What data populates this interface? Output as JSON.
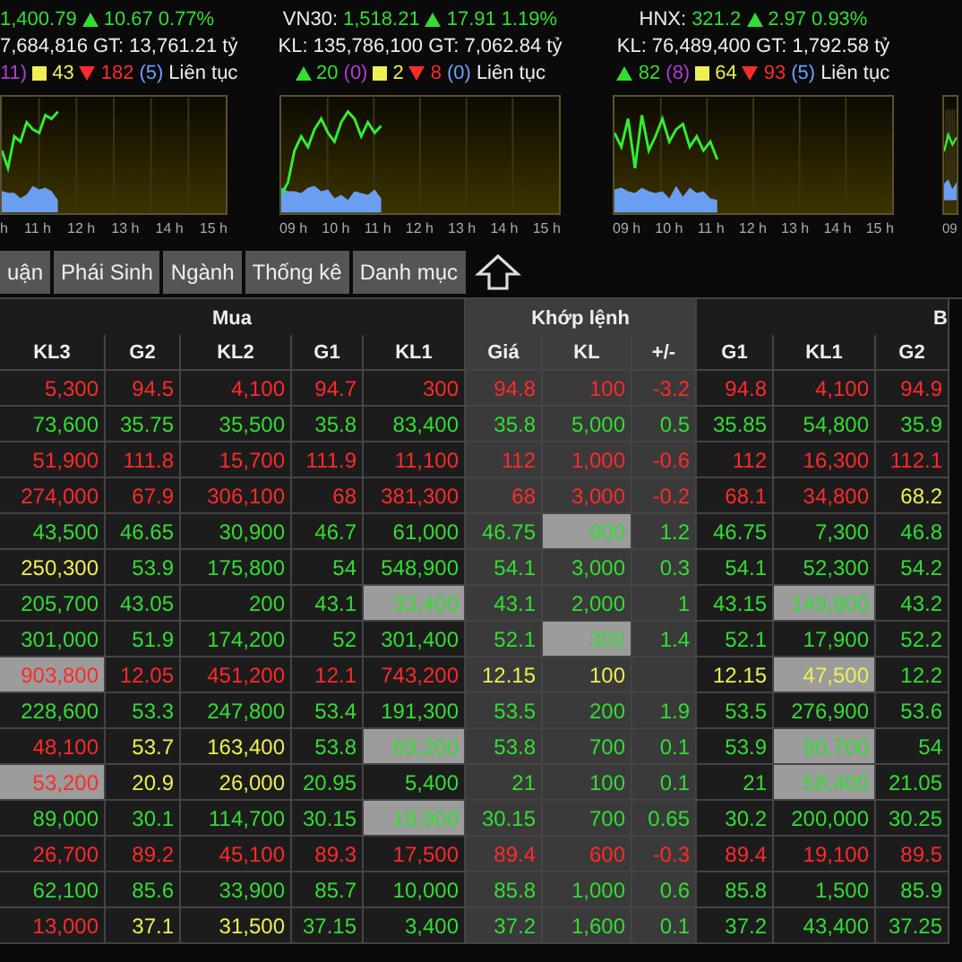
{
  "index_panels": [
    {
      "value": "1,400.79",
      "change": "10.67",
      "percent": "0.77%",
      "volume_line": "7,684,816 GT: 13,761.21 tỷ",
      "breadth": [
        {
          "kind": "ceiling",
          "text": "11)"
        },
        {
          "kind": "same",
          "text": "43"
        },
        {
          "kind": "down",
          "text": "182"
        },
        {
          "kind": "floor",
          "text": "(5)"
        },
        {
          "kind": "status",
          "text": "Liên tục"
        }
      ],
      "axis": [
        "h",
        "11 h",
        "12 h",
        "13 h",
        "14 h",
        "15 h"
      ]
    },
    {
      "title": "VN30:",
      "value": "1,518.21",
      "change": "17.91",
      "percent": "1.19%",
      "volume_line": "KL: 135,786,100 GT: 7,062.84 tỷ",
      "breadth": [
        {
          "kind": "up",
          "text": "20"
        },
        {
          "kind": "ceiling",
          "text": "(0)"
        },
        {
          "kind": "same",
          "text": "2"
        },
        {
          "kind": "down",
          "text": "8"
        },
        {
          "kind": "floor",
          "text": "(0)"
        },
        {
          "kind": "status",
          "text": "Liên tục"
        }
      ],
      "axis": [
        "09 h",
        "10 h",
        "11 h",
        "12 h",
        "13 h",
        "14 h",
        "15 h"
      ]
    },
    {
      "title": "HNX:",
      "value": "321.2",
      "change": "2.97",
      "percent": "0.93%",
      "volume_line": "KL: 76,489,400 GT: 1,792.58 tỷ",
      "breadth": [
        {
          "kind": "up",
          "text": "82"
        },
        {
          "kind": "ceiling",
          "text": "(8)"
        },
        {
          "kind": "same",
          "text": "64"
        },
        {
          "kind": "down",
          "text": "93"
        },
        {
          "kind": "floor",
          "text": "(5)"
        },
        {
          "kind": "status",
          "text": "Liên tục"
        }
      ],
      "axis": [
        "09 h",
        "10 h",
        "11 h",
        "12 h",
        "13 h",
        "14 h",
        "15 h"
      ]
    },
    {
      "axis": [
        "09"
      ]
    }
  ],
  "tabs": [
    {
      "label": "uận",
      "selected": false
    },
    {
      "label": "Phái Sinh",
      "selected": false
    },
    {
      "label": "Ngành",
      "selected": false
    },
    {
      "label": "Thống kê",
      "selected": false
    },
    {
      "label": "Danh mục",
      "selected": false
    }
  ],
  "table": {
    "groups": [
      {
        "kind": "buy",
        "label": "Mua",
        "columns": [
          "KL3",
          "G2",
          "KL2",
          "G1",
          "KL1"
        ]
      },
      {
        "kind": "match",
        "label": "Khớp lệnh",
        "columns": [
          "Giá",
          "KL",
          "+/-"
        ]
      },
      {
        "kind": "sell",
        "label": "B",
        "columns": [
          "G1",
          "KL1",
          "G2"
        ]
      }
    ],
    "rows": [
      {
        "cells": [
          {
            "text": "5,300",
            "kind": "down",
            "highlighted": false
          },
          {
            "text": "94.5",
            "kind": "down",
            "highlighted": false
          },
          {
            "text": "4,100",
            "kind": "down",
            "highlighted": false
          },
          {
            "text": "94.7",
            "kind": "down",
            "highlighted": false
          },
          {
            "text": "300",
            "kind": "down",
            "highlighted": false
          },
          {
            "text": "94.8",
            "kind": "down",
            "highlighted": false
          },
          {
            "text": "100",
            "kind": "down",
            "highlighted": false
          },
          {
            "text": "-3.2",
            "kind": "down",
            "highlighted": false
          },
          {
            "text": "94.8",
            "kind": "down",
            "highlighted": false
          },
          {
            "text": "4,100",
            "kind": "down",
            "highlighted": false
          },
          {
            "text": "94.9",
            "kind": "down",
            "highlighted": false
          }
        ]
      },
      {
        "cells": [
          {
            "text": "73,600",
            "kind": "up",
            "highlighted": false
          },
          {
            "text": "35.75",
            "kind": "up",
            "highlighted": false
          },
          {
            "text": "35,500",
            "kind": "up",
            "highlighted": false
          },
          {
            "text": "35.8",
            "kind": "up",
            "highlighted": false
          },
          {
            "text": "83,400",
            "kind": "up",
            "highlighted": false
          },
          {
            "text": "35.8",
            "kind": "up",
            "highlighted": false
          },
          {
            "text": "5,000",
            "kind": "up",
            "highlighted": false
          },
          {
            "text": "0.5",
            "kind": "up",
            "highlighted": false
          },
          {
            "text": "35.85",
            "kind": "up",
            "highlighted": false
          },
          {
            "text": "54,800",
            "kind": "up",
            "highlighted": false
          },
          {
            "text": "35.9",
            "kind": "up",
            "highlighted": false
          }
        ]
      },
      {
        "cells": [
          {
            "text": "51,900",
            "kind": "down",
            "highlighted": false
          },
          {
            "text": "111.8",
            "kind": "down",
            "highlighted": false
          },
          {
            "text": "15,700",
            "kind": "down",
            "highlighted": false
          },
          {
            "text": "111.9",
            "kind": "down",
            "highlighted": false
          },
          {
            "text": "11,100",
            "kind": "down",
            "highlighted": false
          },
          {
            "text": "112",
            "kind": "down",
            "highlighted": false
          },
          {
            "text": "1,000",
            "kind": "down",
            "highlighted": false
          },
          {
            "text": "-0.6",
            "kind": "down",
            "highlighted": false
          },
          {
            "text": "112",
            "kind": "down",
            "highlighted": false
          },
          {
            "text": "16,300",
            "kind": "down",
            "highlighted": false
          },
          {
            "text": "112.1",
            "kind": "down",
            "highlighted": false
          }
        ]
      },
      {
        "cells": [
          {
            "text": "274,000",
            "kind": "down",
            "highlighted": false
          },
          {
            "text": "67.9",
            "kind": "down",
            "highlighted": false
          },
          {
            "text": "306,100",
            "kind": "down",
            "highlighted": false
          },
          {
            "text": "68",
            "kind": "down",
            "highlighted": false
          },
          {
            "text": "381,300",
            "kind": "down",
            "highlighted": false
          },
          {
            "text": "68",
            "kind": "down",
            "highlighted": false
          },
          {
            "text": "3,000",
            "kind": "down",
            "highlighted": false
          },
          {
            "text": "-0.2",
            "kind": "down",
            "highlighted": false
          },
          {
            "text": "68.1",
            "kind": "down",
            "highlighted": false
          },
          {
            "text": "34,800",
            "kind": "down",
            "highlighted": false
          },
          {
            "text": "68.2",
            "kind": "reference",
            "highlighted": false
          }
        ]
      },
      {
        "cells": [
          {
            "text": "43,500",
            "kind": "up",
            "highlighted": false
          },
          {
            "text": "46.65",
            "kind": "up",
            "highlighted": false
          },
          {
            "text": "30,900",
            "kind": "up",
            "highlighted": false
          },
          {
            "text": "46.7",
            "kind": "up",
            "highlighted": false
          },
          {
            "text": "61,000",
            "kind": "up",
            "highlighted": false
          },
          {
            "text": "46.75",
            "kind": "up",
            "highlighted": false
          },
          {
            "text": "900",
            "kind": "up",
            "highlighted": true
          },
          {
            "text": "1.2",
            "kind": "up",
            "highlighted": false
          },
          {
            "text": "46.75",
            "kind": "up",
            "highlighted": false
          },
          {
            "text": "7,300",
            "kind": "up",
            "highlighted": false
          },
          {
            "text": "46.8",
            "kind": "up",
            "highlighted": false
          }
        ]
      },
      {
        "cells": [
          {
            "text": "250,300",
            "kind": "reference",
            "highlighted": false
          },
          {
            "text": "53.9",
            "kind": "up",
            "highlighted": false
          },
          {
            "text": "175,800",
            "kind": "up",
            "highlighted": false
          },
          {
            "text": "54",
            "kind": "up",
            "highlighted": false
          },
          {
            "text": "548,900",
            "kind": "up",
            "highlighted": false
          },
          {
            "text": "54.1",
            "kind": "up",
            "highlighted": false
          },
          {
            "text": "3,000",
            "kind": "up",
            "highlighted": false
          },
          {
            "text": "0.3",
            "kind": "up",
            "highlighted": false
          },
          {
            "text": "54.1",
            "kind": "up",
            "highlighted": false
          },
          {
            "text": "52,300",
            "kind": "up",
            "highlighted": false
          },
          {
            "text": "54.2",
            "kind": "up",
            "highlighted": false
          }
        ]
      },
      {
        "cells": [
          {
            "text": "205,700",
            "kind": "up",
            "highlighted": false
          },
          {
            "text": "43.05",
            "kind": "up",
            "highlighted": false
          },
          {
            "text": "200",
            "kind": "up",
            "highlighted": false
          },
          {
            "text": "43.1",
            "kind": "up",
            "highlighted": false
          },
          {
            "text": "33,400",
            "kind": "up",
            "highlighted": true
          },
          {
            "text": "43.1",
            "kind": "up",
            "highlighted": false
          },
          {
            "text": "2,000",
            "kind": "up",
            "highlighted": false
          },
          {
            "text": "1",
            "kind": "up",
            "highlighted": false
          },
          {
            "text": "43.15",
            "kind": "up",
            "highlighted": false
          },
          {
            "text": "149,800",
            "kind": "up",
            "highlighted": true
          },
          {
            "text": "43.2",
            "kind": "up",
            "highlighted": false
          }
        ]
      },
      {
        "cells": [
          {
            "text": "301,000",
            "kind": "up",
            "highlighted": false
          },
          {
            "text": "51.9",
            "kind": "up",
            "highlighted": false
          },
          {
            "text": "174,200",
            "kind": "up",
            "highlighted": false
          },
          {
            "text": "52",
            "kind": "up",
            "highlighted": false
          },
          {
            "text": "301,400",
            "kind": "up",
            "highlighted": false
          },
          {
            "text": "52.1",
            "kind": "up",
            "highlighted": false
          },
          {
            "text": "300",
            "kind": "up",
            "highlighted": true
          },
          {
            "text": "1.4",
            "kind": "up",
            "highlighted": false
          },
          {
            "text": "52.1",
            "kind": "up",
            "highlighted": false
          },
          {
            "text": "17,900",
            "kind": "up",
            "highlighted": false
          },
          {
            "text": "52.2",
            "kind": "up",
            "highlighted": false
          }
        ]
      },
      {
        "cells": [
          {
            "text": "903,800",
            "kind": "down",
            "highlighted": true
          },
          {
            "text": "12.05",
            "kind": "down",
            "highlighted": false
          },
          {
            "text": "451,200",
            "kind": "down",
            "highlighted": false
          },
          {
            "text": "12.1",
            "kind": "down",
            "highlighted": false
          },
          {
            "text": "743,200",
            "kind": "down",
            "highlighted": false
          },
          {
            "text": "12.15",
            "kind": "reference",
            "highlighted": false
          },
          {
            "text": "100",
            "kind": "reference",
            "highlighted": false
          },
          {
            "kind": "reference",
            "highlighted": false
          },
          {
            "text": "12.15",
            "kind": "reference",
            "highlighted": false
          },
          {
            "text": "47,500",
            "kind": "reference",
            "highlighted": true
          },
          {
            "text": "12.2",
            "kind": "up",
            "highlighted": false
          }
        ]
      },
      {
        "cells": [
          {
            "text": "228,600",
            "kind": "up",
            "highlighted": false
          },
          {
            "text": "53.3",
            "kind": "up",
            "highlighted": false
          },
          {
            "text": "247,800",
            "kind": "up",
            "highlighted": false
          },
          {
            "text": "53.4",
            "kind": "up",
            "highlighted": false
          },
          {
            "text": "191,300",
            "kind": "up",
            "highlighted": false
          },
          {
            "text": "53.5",
            "kind": "up",
            "highlighted": false
          },
          {
            "text": "200",
            "kind": "up",
            "highlighted": false
          },
          {
            "text": "1.9",
            "kind": "up",
            "highlighted": false
          },
          {
            "text": "53.5",
            "kind": "up",
            "highlighted": false
          },
          {
            "text": "276,900",
            "kind": "up",
            "highlighted": false
          },
          {
            "text": "53.6",
            "kind": "up",
            "highlighted": false
          }
        ]
      },
      {
        "cells": [
          {
            "text": "48,100",
            "kind": "down",
            "highlighted": false
          },
          {
            "text": "53.7",
            "kind": "reference",
            "highlighted": false
          },
          {
            "text": "163,400",
            "kind": "reference",
            "highlighted": false
          },
          {
            "text": "53.8",
            "kind": "up",
            "highlighted": false
          },
          {
            "text": "69,200",
            "kind": "up",
            "highlighted": true
          },
          {
            "text": "53.8",
            "kind": "up",
            "highlighted": false
          },
          {
            "text": "700",
            "kind": "up",
            "highlighted": false
          },
          {
            "text": "0.1",
            "kind": "up",
            "highlighted": false
          },
          {
            "text": "53.9",
            "kind": "up",
            "highlighted": false
          },
          {
            "text": "80,700",
            "kind": "up",
            "highlighted": true
          },
          {
            "text": "54",
            "kind": "up",
            "highlighted": false
          }
        ]
      },
      {
        "cells": [
          {
            "text": "53,200",
            "kind": "down",
            "highlighted": true
          },
          {
            "text": "20.9",
            "kind": "reference",
            "highlighted": false
          },
          {
            "text": "26,000",
            "kind": "reference",
            "highlighted": false
          },
          {
            "text": "20.95",
            "kind": "up",
            "highlighted": false
          },
          {
            "text": "5,400",
            "kind": "up",
            "highlighted": false
          },
          {
            "text": "21",
            "kind": "up",
            "highlighted": false
          },
          {
            "text": "100",
            "kind": "up",
            "highlighted": false
          },
          {
            "text": "0.1",
            "kind": "up",
            "highlighted": false
          },
          {
            "text": "21",
            "kind": "up",
            "highlighted": false
          },
          {
            "text": "58,400",
            "kind": "up",
            "highlighted": true
          },
          {
            "text": "21.05",
            "kind": "up",
            "highlighted": false
          }
        ]
      },
      {
        "cells": [
          {
            "text": "89,000",
            "kind": "up",
            "highlighted": false
          },
          {
            "text": "30.1",
            "kind": "up",
            "highlighted": false
          },
          {
            "text": "114,700",
            "kind": "up",
            "highlighted": false
          },
          {
            "text": "30.15",
            "kind": "up",
            "highlighted": false
          },
          {
            "text": "18,900",
            "kind": "up",
            "highlighted": true
          },
          {
            "text": "30.15",
            "kind": "up",
            "highlighted": false
          },
          {
            "text": "700",
            "kind": "up",
            "highlighted": false
          },
          {
            "text": "0.65",
            "kind": "up",
            "highlighted": false
          },
          {
            "text": "30.2",
            "kind": "up",
            "highlighted": false
          },
          {
            "text": "200,000",
            "kind": "up",
            "highlighted": false
          },
          {
            "text": "30.25",
            "kind": "up",
            "highlighted": false
          }
        ]
      },
      {
        "cells": [
          {
            "text": "26,700",
            "kind": "down",
            "highlighted": false
          },
          {
            "text": "89.2",
            "kind": "down",
            "highlighted": false
          },
          {
            "text": "45,100",
            "kind": "down",
            "highlighted": false
          },
          {
            "text": "89.3",
            "kind": "down",
            "highlighted": false
          },
          {
            "text": "17,500",
            "kind": "down",
            "highlighted": false
          },
          {
            "text": "89.4",
            "kind": "down",
            "highlighted": false
          },
          {
            "text": "600",
            "kind": "down",
            "highlighted": false
          },
          {
            "text": "-0.3",
            "kind": "down",
            "highlighted": false
          },
          {
            "text": "89.4",
            "kind": "down",
            "highlighted": false
          },
          {
            "text": "19,100",
            "kind": "down",
            "highlighted": false
          },
          {
            "text": "89.5",
            "kind": "down",
            "highlighted": false
          }
        ]
      },
      {
        "cells": [
          {
            "text": "62,100",
            "kind": "up",
            "highlighted": false
          },
          {
            "text": "85.6",
            "kind": "up",
            "highlighted": false
          },
          {
            "text": "33,900",
            "kind": "up",
            "highlighted": false
          },
          {
            "text": "85.7",
            "kind": "up",
            "highlighted": false
          },
          {
            "text": "10,000",
            "kind": "up",
            "highlighted": false
          },
          {
            "text": "85.8",
            "kind": "up",
            "highlighted": false
          },
          {
            "text": "1,000",
            "kind": "up",
            "highlighted": false
          },
          {
            "text": "0.6",
            "kind": "up",
            "highlighted": false
          },
          {
            "text": "85.8",
            "kind": "up",
            "highlighted": false
          },
          {
            "text": "1,500",
            "kind": "up",
            "highlighted": false
          },
          {
            "text": "85.9",
            "kind": "up",
            "highlighted": false
          }
        ]
      },
      {
        "cells": [
          {
            "text": "13,000",
            "kind": "down",
            "highlighted": false
          },
          {
            "text": "37.1",
            "kind": "reference",
            "highlighted": false
          },
          {
            "text": "31,500",
            "kind": "reference",
            "highlighted": false
          },
          {
            "text": "37.15",
            "kind": "up",
            "highlighted": false
          },
          {
            "text": "3,400",
            "kind": "up",
            "highlighted": false
          },
          {
            "text": "37.2",
            "kind": "up",
            "highlighted": false
          },
          {
            "text": "1,600",
            "kind": "up",
            "highlighted": false
          },
          {
            "text": "0.1",
            "kind": "up",
            "highlighted": false
          },
          {
            "text": "37.2",
            "kind": "up",
            "highlighted": false
          },
          {
            "text": "43,400",
            "kind": "up",
            "highlighted": false
          },
          {
            "text": "37.25",
            "kind": "up",
            "highlighted": false
          }
        ]
      }
    ]
  }
}
